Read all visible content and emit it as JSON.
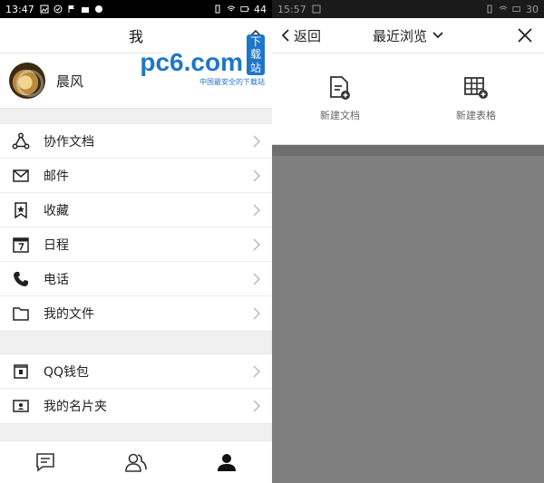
{
  "left": {
    "status": {
      "time": "13:47",
      "battery": "44"
    },
    "header": {
      "title": "我"
    },
    "profile": {
      "name": "晨风"
    },
    "watermark": {
      "brand": "pc6.com",
      "tag": "下载站",
      "sub": "中国最安全的下载站"
    },
    "menu1": [
      {
        "label": "协作文档",
        "icon": "collaboration-icon"
      },
      {
        "label": "邮件",
        "icon": "mail-icon"
      },
      {
        "label": "收藏",
        "icon": "bookmark-icon"
      },
      {
        "label": "日程",
        "icon": "calendar-icon"
      },
      {
        "label": "电话",
        "icon": "phone-icon"
      },
      {
        "label": "我的文件",
        "icon": "folder-icon"
      }
    ],
    "menu2": [
      {
        "label": "QQ钱包",
        "icon": "wallet-icon"
      },
      {
        "label": "我的名片夹",
        "icon": "card-holder-icon"
      }
    ],
    "tabs": [
      {
        "icon": "message-icon"
      },
      {
        "icon": "contacts-icon"
      },
      {
        "icon": "profile-icon"
      }
    ]
  },
  "right": {
    "status": {
      "time": "15:57",
      "battery": "30"
    },
    "header": {
      "back": "返回",
      "title": "最近浏览"
    },
    "actions": [
      {
        "label": "新建文档",
        "icon": "new-document-icon"
      },
      {
        "label": "新建表格",
        "icon": "new-table-icon"
      }
    ]
  },
  "colors": {
    "brand": "#1e76c8",
    "overlay": "#7f7f7f"
  }
}
